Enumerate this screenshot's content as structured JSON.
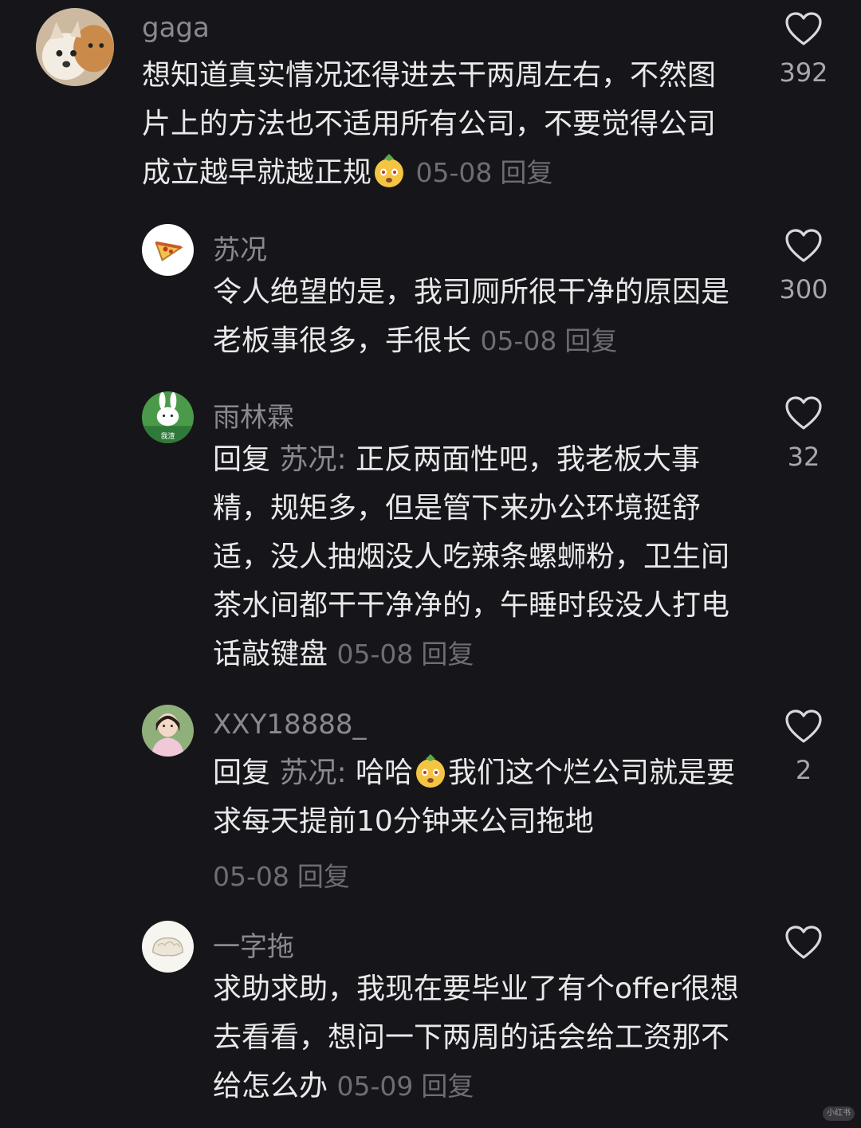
{
  "comments": [
    {
      "username": "gaga",
      "text": "想知道真实情况还得进去干两周左右，不然图片上的方法也不适用所有公司，不要觉得公司成立越早就越正规",
      "emoji": "pineapple-face-emoji",
      "date": "05-08",
      "reply_label": "回复",
      "likes": "392"
    },
    {
      "username": "苏况",
      "text": "令人绝望的是，我司厕所很干净的原因是老板事很多，手很长",
      "date": "05-08",
      "reply_label": "回复",
      "likes": "300"
    },
    {
      "username": "雨林霖",
      "reply_prefix": "回复 ",
      "reply_target": "苏况:",
      "text": " 正反两面性吧，我老板大事精，规矩多，但是管下来办公环境挺舒适，没人抽烟没人吃辣条螺蛳粉，卫生间茶水间都干干净净的，午睡时段没人打电话敲键盘",
      "date": "05-08",
      "reply_label": "回复",
      "likes": "32"
    },
    {
      "username": "XXY18888_",
      "reply_prefix": "回复 ",
      "reply_target": "苏况:",
      "text_before": " 哈哈",
      "emoji": "pineapple-face-emoji",
      "text_after": "我们这个烂公司就是要求每天提前10分钟来公司拖地",
      "date": "05-08",
      "reply_label": "回复",
      "likes": "2"
    },
    {
      "username": "一字拖",
      "text": "求助求助，我现在要毕业了有个offer很想去看看，想问一下两周的话会给工资那不给怎么办",
      "date": "05-09",
      "reply_label": "回复",
      "likes": ""
    }
  ],
  "watermark": "小红书",
  "colors": {
    "background": "#16161a",
    "text": "#e9e9eb",
    "muted": "#8a8a8e",
    "meta": "#6e6e72"
  },
  "icons": {
    "like": "heart-outline-icon"
  }
}
